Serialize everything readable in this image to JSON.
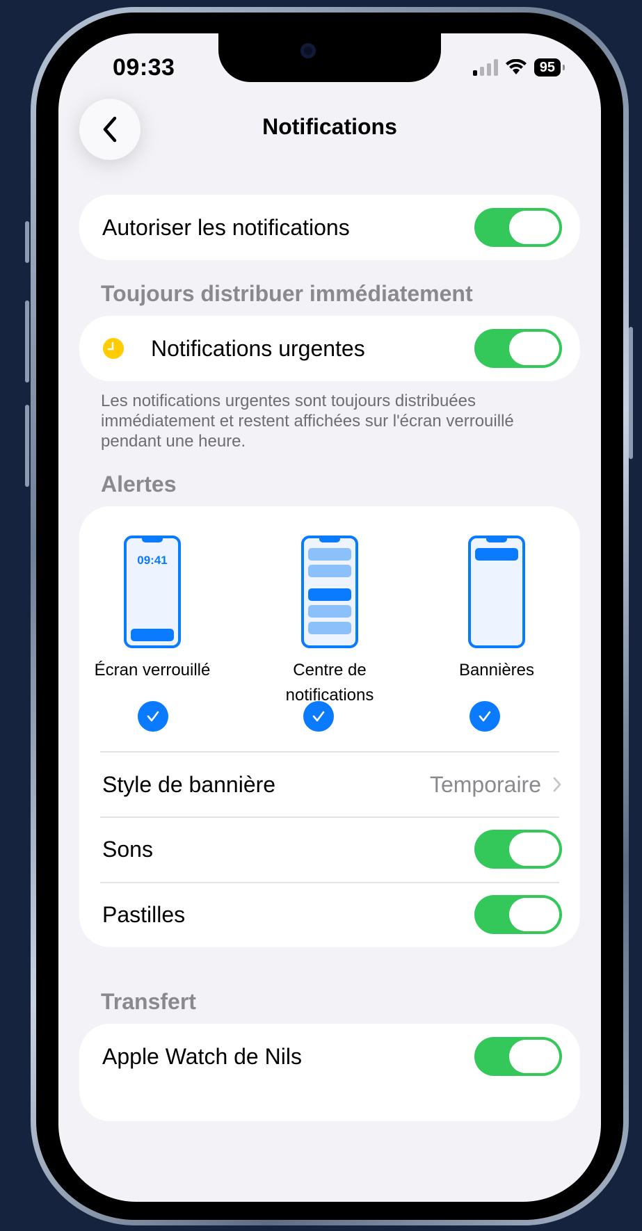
{
  "status_bar": {
    "time": "09:33",
    "battery": "95"
  },
  "nav": {
    "title": "Notifications"
  },
  "allow": {
    "label": "Autoriser les notifications",
    "enabled": true
  },
  "urgent_section": {
    "header": "Toujours distribuer immédiatement",
    "label": "Notifications urgentes",
    "enabled": true,
    "footnote": "Les notifications urgentes sont toujours distribuées immédiatement et restent affichées sur l'écran verrouillé pendant une heure.",
    "icon_color": "#ffcc00"
  },
  "alerts": {
    "header": "Alertes",
    "options": [
      {
        "label": "Écran verrouillé",
        "mini_time": "09:41",
        "checked": true
      },
      {
        "label": "Centre de notifications",
        "checked": true
      },
      {
        "label": "Bannières",
        "checked": true
      }
    ],
    "banner_style": {
      "label": "Style de bannière",
      "value": "Temporaire"
    },
    "sounds": {
      "label": "Sons",
      "enabled": true
    },
    "badges": {
      "label": "Pastilles",
      "enabled": true
    }
  },
  "transfer": {
    "header": "Transfert",
    "label": "Apple Watch de Nils",
    "enabled": true
  },
  "colors": {
    "accent": "#0a7aff",
    "toggle_on": "#34c759",
    "background": "#f2f2f7"
  }
}
